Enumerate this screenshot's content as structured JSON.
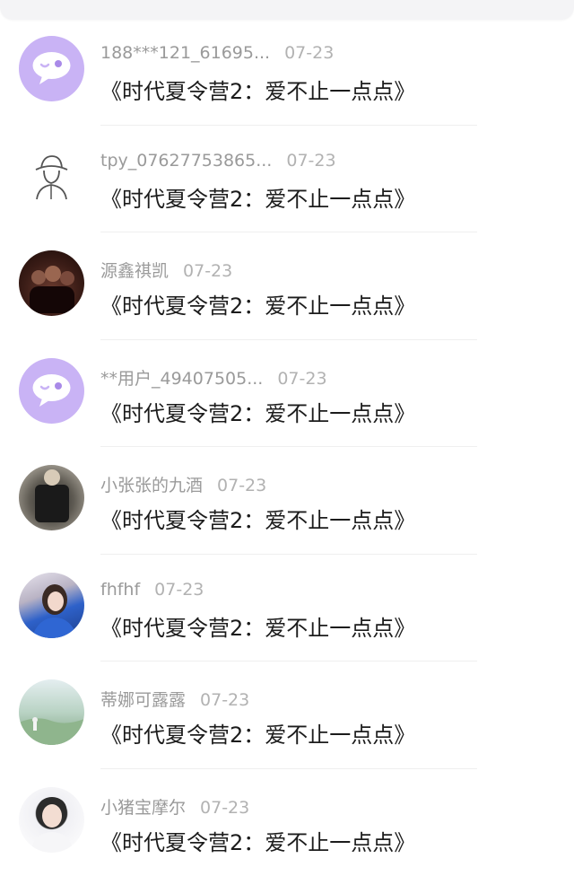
{
  "messages": [
    {
      "name": "188***121_61695...",
      "date": "07-23",
      "title": "《时代夏令营2：爱不止一点点》",
      "avatar": "purple-chat-bubble"
    },
    {
      "name": "tpy_07627753865...",
      "date": "07-23",
      "title": "《时代夏令营2：爱不止一点点》",
      "avatar": "hat-person-sketch"
    },
    {
      "name": "源鑫祺凯",
      "date": "07-23",
      "title": "《时代夏令营2：爱不止一点点》",
      "avatar": "group-photo"
    },
    {
      "name": "**用户_49407505...",
      "date": "07-23",
      "title": "《时代夏令营2：爱不止一点点》",
      "avatar": "purple-chat-bubble"
    },
    {
      "name": "小张张的九酒",
      "date": "07-23",
      "title": "《时代夏令营2：爱不止一点点》",
      "avatar": "person-photo"
    },
    {
      "name": "fhfhf",
      "date": "07-23",
      "title": "《时代夏令营2：爱不止一点点》",
      "avatar": "girl-photo"
    },
    {
      "name": "蒂娜可露露",
      "date": "07-23",
      "title": "《时代夏令营2：爱不止一点点》",
      "avatar": "landscape-photo"
    },
    {
      "name": "小猪宝摩尔",
      "date": "07-23",
      "title": "《时代夏令营2：爱不止一点点》",
      "avatar": "boy-photo"
    }
  ],
  "colors": {
    "avatar_purple": "#c9b3f5",
    "name_text": "#9a9a9a",
    "date_text": "#b2b2b2",
    "title_text": "#1c1c1c",
    "divider": "#efefef"
  }
}
